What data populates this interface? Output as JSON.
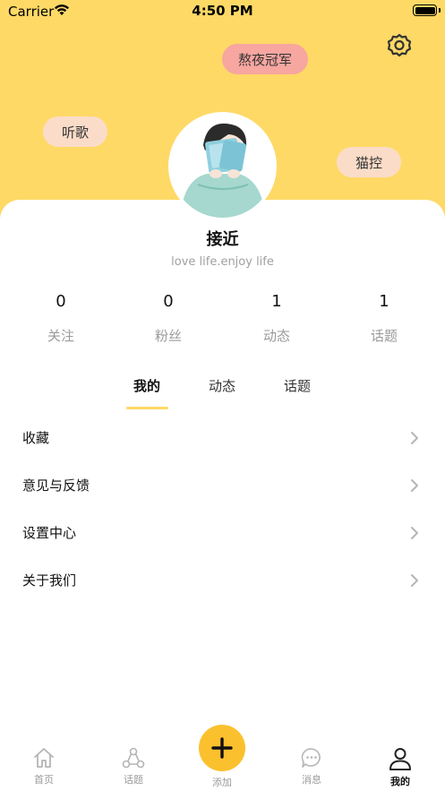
{
  "status_bar": {
    "carrier": "Carrier",
    "time": "4:50 PM"
  },
  "header": {
    "tags": [
      "熬夜冠军",
      "听歌",
      "猫控"
    ],
    "settings_icon": "gear-icon"
  },
  "profile": {
    "username": "接近",
    "bio": "love life.enjoy life"
  },
  "stats": [
    {
      "value": "0",
      "label": "关注"
    },
    {
      "value": "0",
      "label": "粉丝"
    },
    {
      "value": "1",
      "label": "动态"
    },
    {
      "value": "1",
      "label": "话题"
    }
  ],
  "tabs": [
    {
      "label": "我的",
      "active": true
    },
    {
      "label": "动态",
      "active": false
    },
    {
      "label": "话题",
      "active": false
    }
  ],
  "menu": [
    {
      "label": "收藏"
    },
    {
      "label": "意见与反馈"
    },
    {
      "label": "设置中心"
    },
    {
      "label": "关于我们"
    }
  ],
  "tabbar": {
    "items": [
      {
        "label": "首页",
        "icon": "home-icon"
      },
      {
        "label": "话题",
        "icon": "topics-icon"
      },
      {
        "label": "添加",
        "icon": "plus-icon"
      },
      {
        "label": "消息",
        "icon": "message-icon"
      },
      {
        "label": "我的",
        "icon": "user-icon"
      }
    ],
    "active": "我的"
  },
  "colors": {
    "header": "#fed966",
    "accent": "#fbc02d",
    "tag_pink": "#f7a6a0",
    "tag_peach": "#fbdcc8"
  }
}
